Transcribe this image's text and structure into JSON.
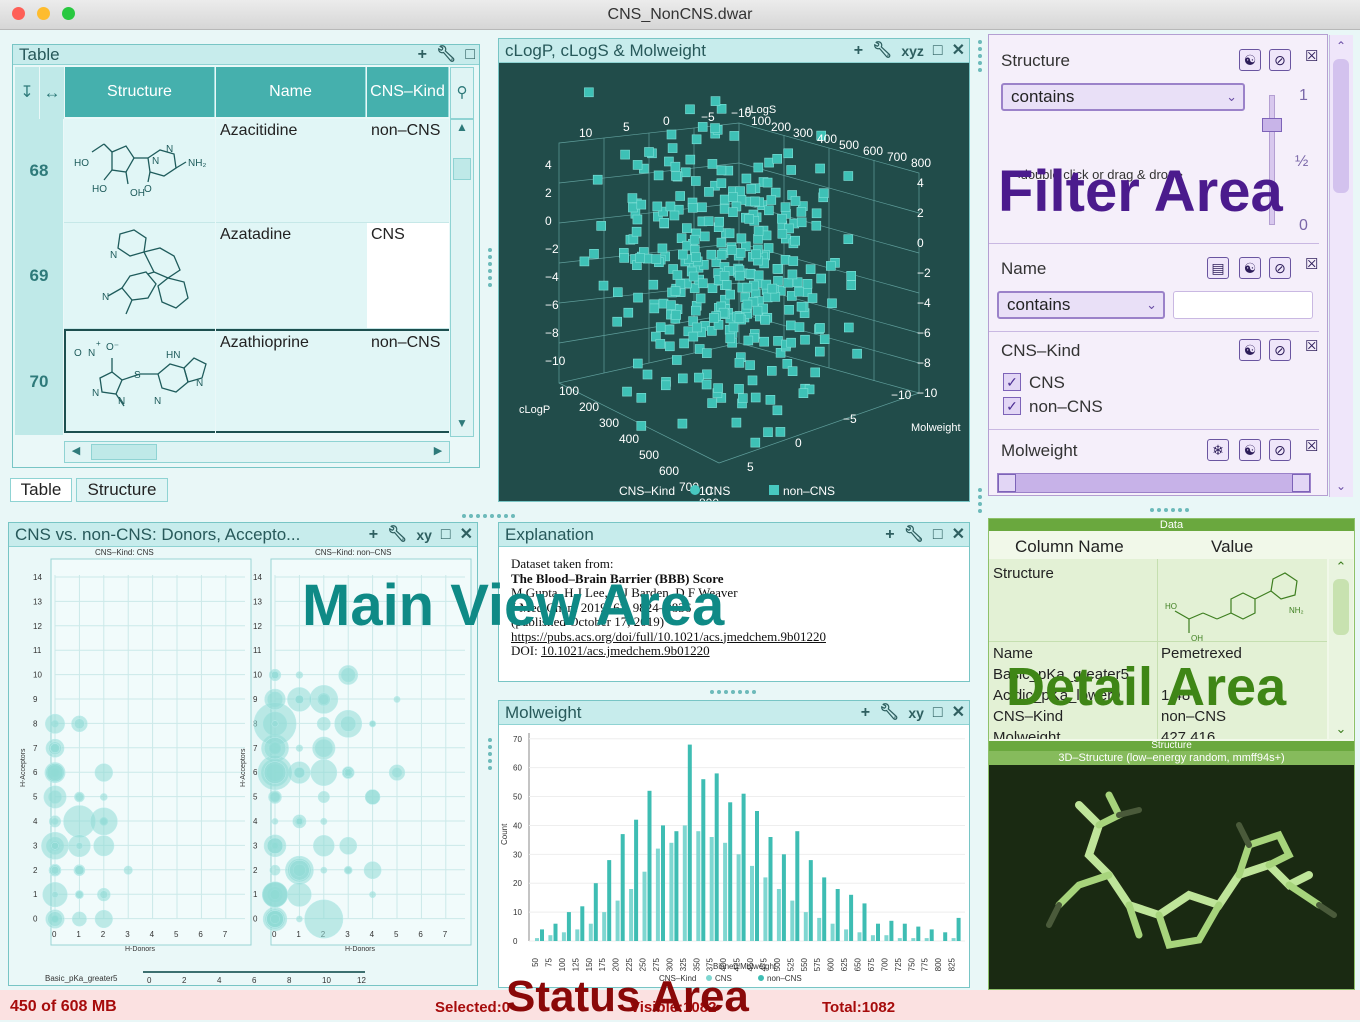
{
  "window": {
    "title": "CNS_NonCNS.dwar"
  },
  "table_view": {
    "title": "Table",
    "columns": [
      "Structure",
      "Name",
      "CNS–Kind"
    ],
    "rows": [
      {
        "num": "68",
        "name": "Azacitidine",
        "kind": "non–CNS"
      },
      {
        "num": "69",
        "name": "Azatadine",
        "kind": "CNS"
      },
      {
        "num": "70",
        "name": "Azathioprine",
        "kind": "non–CNS"
      }
    ],
    "tabs": [
      "Table",
      "Structure"
    ],
    "mol_labels": {
      "r68": [
        "HO",
        "HO",
        "OH",
        "NH₂",
        "N",
        "N",
        "N",
        "O",
        "O"
      ],
      "r69": [
        "N",
        "N"
      ],
      "r70": [
        "O",
        "N",
        "O⁻",
        "+",
        "HN",
        "N",
        "N",
        "N",
        "N",
        "S",
        "N"
      ]
    }
  },
  "view3d": {
    "title": "cLogP, cLogS & Molweight",
    "tools": [
      "+",
      "xyz"
    ],
    "axis_names": {
      "x": "cLogP",
      "y": "cLogS",
      "z": "Molweight"
    },
    "ticks_top": [
      "10",
      "5",
      "0",
      "−5",
      "−10",
      "100",
      "200",
      "300",
      "400",
      "500",
      "600",
      "700",
      "800"
    ],
    "ticks_left": [
      "4",
      "2",
      "0",
      "−2",
      "−4",
      "−6",
      "−8",
      "−10"
    ],
    "ticks_right": [
      "4",
      "2",
      "0",
      "−2",
      "−4",
      "−6",
      "−8",
      "−10"
    ],
    "ticks_bottom_left": [
      "100",
      "200",
      "300",
      "400",
      "500",
      "600",
      "700",
      "800"
    ],
    "ticks_bottom_right": [
      "−10",
      "−5",
      "0",
      "5",
      "10"
    ],
    "legend": {
      "title": "CNS–Kind",
      "items": [
        "CNS",
        "non–CNS"
      ]
    }
  },
  "bubble_view": {
    "title": "CNS vs. non-CNS: Donors, Accepto...",
    "tools": [
      "+",
      "xy"
    ],
    "panel_titles": [
      "CNS–Kind: CNS",
      "CNS–Kind: non–CNS"
    ],
    "y_ticks": [
      "14",
      "13",
      "12",
      "11",
      "10",
      "9",
      "8",
      "7",
      "6",
      "5",
      "4",
      "3",
      "2",
      "1",
      "0"
    ],
    "x_ticks": [
      "0",
      "1",
      "2",
      "3",
      "4",
      "5",
      "6",
      "7"
    ],
    "y_label": "H-Acceptors",
    "x_label": "H-Donors",
    "size_legend": {
      "label": "Basic_pKa_greater5",
      "ticks": [
        "0",
        "2",
        "4",
        "6",
        "8",
        "10",
        "12"
      ]
    }
  },
  "explanation": {
    "title": "Explanation",
    "lines": [
      "Dataset taken from:",
      "The Blood–Brain Barrier (BBB) Score",
      "M Gupta, H J Lee, C J Barden, D F Weaver",
      "J Med Chem 2019, 62, 9824–9836",
      "(published October 17, 2019)"
    ],
    "link": "https://pubs.acs.org/doi/full/10.1021/acs.jmedchem.9b01220",
    "doi_prefix": "DOI: ",
    "doi": "10.1021/acs.jmedchem.9b01220"
  },
  "histogram": {
    "title": "Molweight",
    "tools": [
      "+",
      "xy"
    ],
    "y_label": "Count",
    "x_label": "Binned Molweight",
    "legend": {
      "title": "CNS–Kind",
      "items": [
        "CNS",
        "non–CNS"
      ]
    }
  },
  "chart_data": {
    "type": "bar",
    "title": "Molweight",
    "xlabel": "Binned Molweight",
    "ylabel": "Count",
    "ylim": [
      0,
      72
    ],
    "y_ticks": [
      0,
      10,
      20,
      30,
      40,
      50,
      60,
      70
    ],
    "categories": [
      "50",
      "75",
      "100",
      "125",
      "150",
      "175",
      "200",
      "225",
      "250",
      "275",
      "300",
      "325",
      "350",
      "375",
      "400",
      "425",
      "450",
      "475",
      "500",
      "525",
      "550",
      "575",
      "600",
      "625",
      "650",
      "675",
      "700",
      "725",
      "750",
      "775",
      "800",
      "825"
    ],
    "series": [
      {
        "name": "CNS",
        "values": [
          1,
          2,
          3,
          4,
          6,
          10,
          14,
          18,
          24,
          32,
          34,
          40,
          38,
          36,
          34,
          30,
          26,
          22,
          18,
          14,
          10,
          8,
          6,
          4,
          3,
          2,
          2,
          1,
          1,
          1,
          0,
          1
        ]
      },
      {
        "name": "non–CNS",
        "values": [
          4,
          6,
          10,
          12,
          20,
          28,
          37,
          42,
          52,
          40,
          38,
          68,
          56,
          58,
          48,
          51,
          45,
          36,
          30,
          38,
          28,
          22,
          18,
          16,
          13,
          6,
          7,
          6,
          5,
          4,
          3,
          8
        ]
      }
    ]
  },
  "filter": {
    "title": "Filter Area",
    "structure": {
      "label": "Structure",
      "mode": "contains",
      "hint": "<double click or drag & drop>",
      "slider_ticks": [
        "1",
        "½",
        "0"
      ]
    },
    "name": {
      "label": "Name",
      "mode": "contains",
      "value": ""
    },
    "kind": {
      "label": "CNS–Kind",
      "options": [
        "CNS",
        "non–CNS"
      ]
    },
    "molweight": {
      "label": "Molweight"
    }
  },
  "detail": {
    "title": "Detail Area",
    "section": "Data",
    "headers": [
      "Column Name",
      "Value"
    ],
    "rows": [
      {
        "k": "Structure",
        "v": ""
      },
      {
        "k": "Name",
        "v": "Pemetrexed"
      },
      {
        "k": "Basic_pKa_greater5",
        "v": ""
      },
      {
        "k": "Acidic_pKa_lower9",
        "v": "1.48"
      },
      {
        "k": "CNS–Kind",
        "v": "non–CNS"
      },
      {
        "k": "Molweight",
        "v": "427.416"
      }
    ],
    "structure_section": "Structure",
    "structure_sub": "3D–Structure (low–energy random, mmff94s+)"
  },
  "overlays": {
    "main": "Main View Area",
    "status": "Status Area"
  },
  "status": {
    "memory": "450 of 608 MB",
    "selected": "Selected:0",
    "visible": "Visible:1082",
    "total": "Total:1082"
  },
  "colors": {
    "accent": "#45b0ad",
    "filter": "#4b1b8d",
    "detail": "#3f8616",
    "status_text": "#8a0808",
    "main_label": "#0f8a86"
  }
}
